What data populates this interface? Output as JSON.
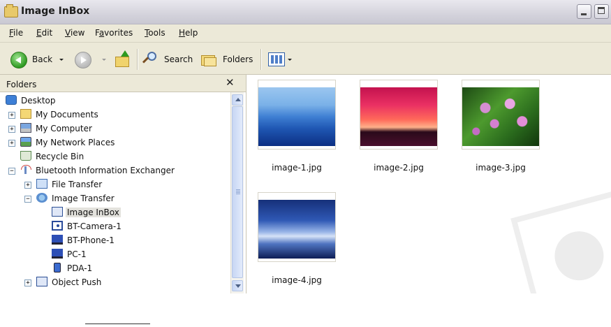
{
  "window": {
    "title": "Image InBox"
  },
  "menu": [
    {
      "label": "File",
      "accel": "F",
      "rest": "ile"
    },
    {
      "label": "Edit",
      "accel": "E",
      "rest": "dit"
    },
    {
      "label": "View",
      "accel": "V",
      "rest": "iew"
    },
    {
      "label": "Favorites",
      "accel": "a",
      "pre": "F",
      "rest": "vorites"
    },
    {
      "label": "Tools",
      "accel": "T",
      "rest": "ools"
    },
    {
      "label": "Help",
      "accel": "H",
      "rest": "elp"
    }
  ],
  "toolbar": {
    "back_label": "Back",
    "search_label": "Search",
    "folders_label": "Folders"
  },
  "folder_pane": {
    "title": "Folders",
    "close_glyph": "✕",
    "tree": [
      {
        "label": "Desktop",
        "icon": "desktop-icon"
      },
      {
        "label": "My Documents",
        "icon": "folder-icon",
        "expander": "+"
      },
      {
        "label": "My Computer",
        "icon": "computer-icon",
        "expander": "+"
      },
      {
        "label": "My Network Places",
        "icon": "network-icon",
        "expander": "+"
      },
      {
        "label": "Recycle Bin",
        "icon": "recycle-bin-icon"
      },
      {
        "label": "Bluetooth Information Exchanger",
        "icon": "bluetooth-icon",
        "expander": "−"
      },
      {
        "label": "File Transfer",
        "icon": "file-transfer-icon",
        "expander": "+"
      },
      {
        "label": "Image Transfer",
        "icon": "image-transfer-icon",
        "expander": "−"
      },
      {
        "label": "Image InBox",
        "icon": "inbox-icon",
        "selected": true
      },
      {
        "label": "BT-Camera-1",
        "icon": "camera-icon"
      },
      {
        "label": "BT-Phone-1",
        "icon": "phone-icon"
      },
      {
        "label": "PC-1",
        "icon": "pc-icon"
      },
      {
        "label": "PDA-1",
        "icon": "pda-icon"
      },
      {
        "label": "Object Push",
        "icon": "object-push-icon",
        "expander": "+"
      }
    ]
  },
  "files": [
    {
      "name": "image-1.jpg"
    },
    {
      "name": "image-2.jpg"
    },
    {
      "name": "image-3.jpg"
    },
    {
      "name": "image-4.jpg"
    }
  ]
}
